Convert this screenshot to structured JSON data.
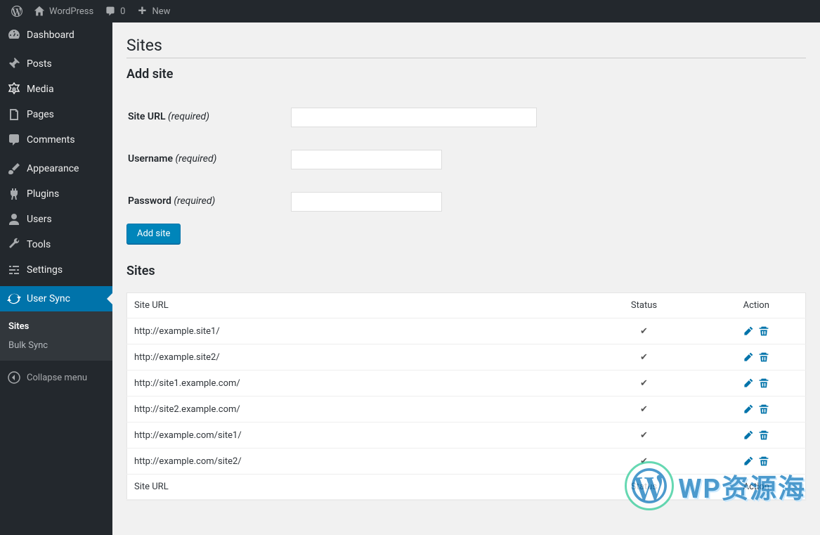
{
  "adminbar": {
    "wp": "WordPress",
    "comments": "0",
    "new": "New"
  },
  "sidebar": {
    "dashboard": "Dashboard",
    "posts": "Posts",
    "media": "Media",
    "pages": "Pages",
    "comments": "Comments",
    "appearance": "Appearance",
    "plugins": "Plugins",
    "users": "Users",
    "tools": "Tools",
    "settings": "Settings",
    "usersync": "User Sync",
    "submenu": {
      "sites": "Sites",
      "bulksync": "Bulk Sync"
    },
    "collapse": "Collapse menu"
  },
  "page": {
    "title": "Sites",
    "add_heading": "Add site",
    "site_url_label": "Site URL",
    "username_label": "Username",
    "password_label": "Password",
    "required": "(required)",
    "add_button": "Add site",
    "list_heading": "Sites",
    "th_url": "Site URL",
    "th_status": "Status",
    "th_action": "Action",
    "rows": [
      {
        "url": "http://example.site1/"
      },
      {
        "url": "http://example.site2/"
      },
      {
        "url": "http://site1.example.com/"
      },
      {
        "url": "http://site2.example.com/"
      },
      {
        "url": "http://example.com/site1/"
      },
      {
        "url": "http://example.com/site2/"
      }
    ]
  },
  "watermark": "WP资源海"
}
